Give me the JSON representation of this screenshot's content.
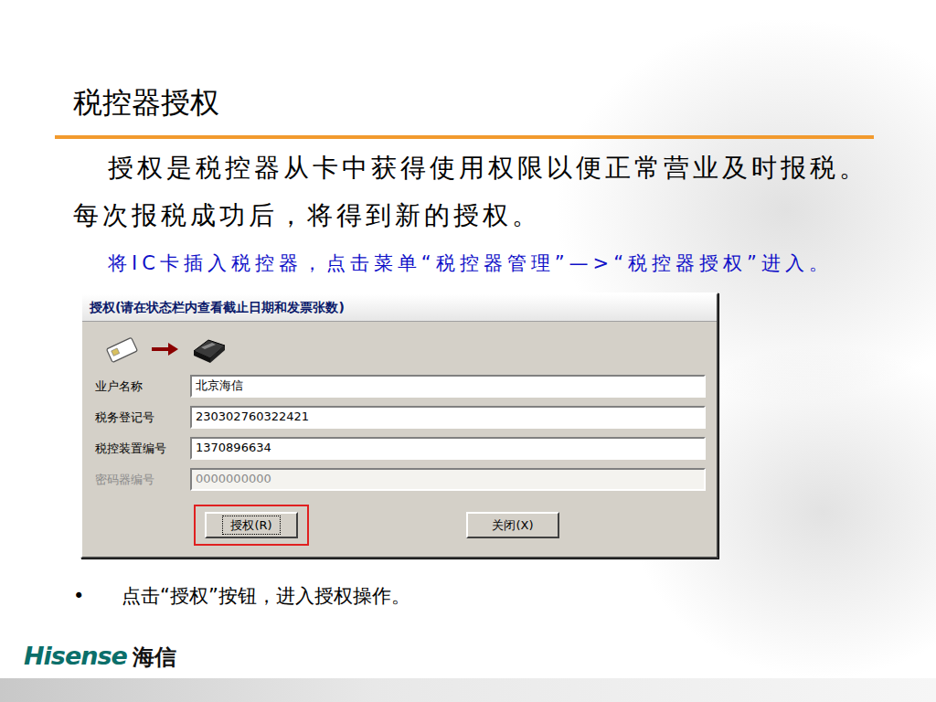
{
  "slide": {
    "title": "税控器授权",
    "paragraph": "授权是税控器从卡中获得使用权限以便正常营业及时报税。每次报税成功后，将得到新的授权。",
    "instruction": "将IC卡插入税控器，点击菜单“税控器管理”—>“税控器授权”进入。",
    "bullet_mark": "•",
    "bullet": "点击“授权”按钮，进入授权操作。"
  },
  "dialog": {
    "title": "授权(请在状态栏内查看截止日期和发票张数)",
    "fields": [
      {
        "label": "业户名称",
        "value": "北京海信",
        "disabled": false
      },
      {
        "label": "税务登记号",
        "value": "230302760322421",
        "disabled": false
      },
      {
        "label": "税控装置编号",
        "value": "1370896634",
        "disabled": false
      },
      {
        "label": "密码器编号",
        "value": "0000000000",
        "disabled": true
      }
    ],
    "buttons": [
      {
        "label": "授权(R)",
        "highlighted": true
      },
      {
        "label": "关闭(X)",
        "highlighted": false
      }
    ]
  },
  "logo": {
    "brand": "Hisense",
    "chinese": "海信"
  }
}
